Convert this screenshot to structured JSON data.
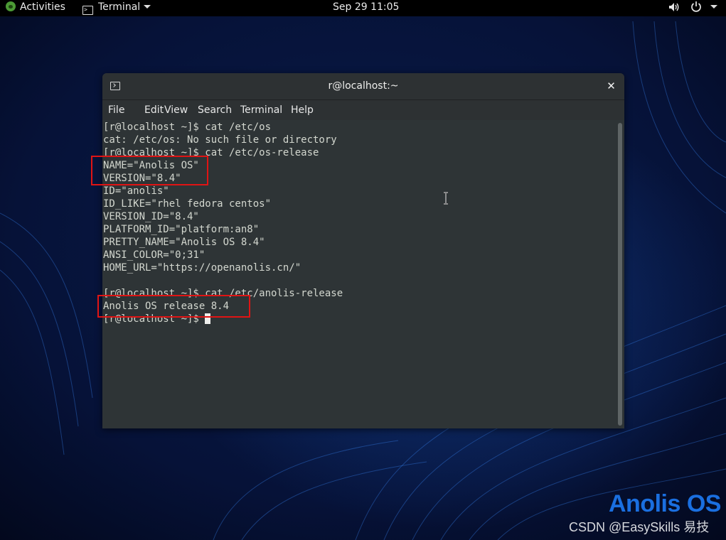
{
  "topbar": {
    "activities": "Activities",
    "app_menu": "Terminal",
    "clock": "Sep 29  11:05",
    "icons": [
      "activities-logo-icon",
      "terminal-icon",
      "volume-icon",
      "power-icon",
      "chevron-down-icon"
    ]
  },
  "window": {
    "title": "r@localhost:~",
    "close_glyph": "✕",
    "menus": [
      "File",
      "Edit",
      "View",
      "Search",
      "Terminal",
      "Help"
    ]
  },
  "terminal": {
    "lines": [
      "[r@localhost ~]$ cat /etc/os",
      "cat: /etc/os: No such file or directory",
      "[r@localhost ~]$ cat /etc/os-release",
      "NAME=\"Anolis OS\"",
      "VERSION=\"8.4\"",
      "ID=\"anolis\"",
      "ID_LIKE=\"rhel fedora centos\"",
      "VERSION_ID=\"8.4\"",
      "PLATFORM_ID=\"platform:an8\"",
      "PRETTY_NAME=\"Anolis OS 8.4\"",
      "ANSI_COLOR=\"0;31\"",
      "HOME_URL=\"https://openanolis.cn/\"",
      "",
      "[r@localhost ~]$ cat /etc/anolis-release",
      "Anolis OS release 8.4",
      "[r@localhost ~]$ "
    ]
  },
  "annotation_color": "#e01414",
  "brand_logo_text": "Anolis OS",
  "watermark": "CSDN @EasySkills 易技"
}
